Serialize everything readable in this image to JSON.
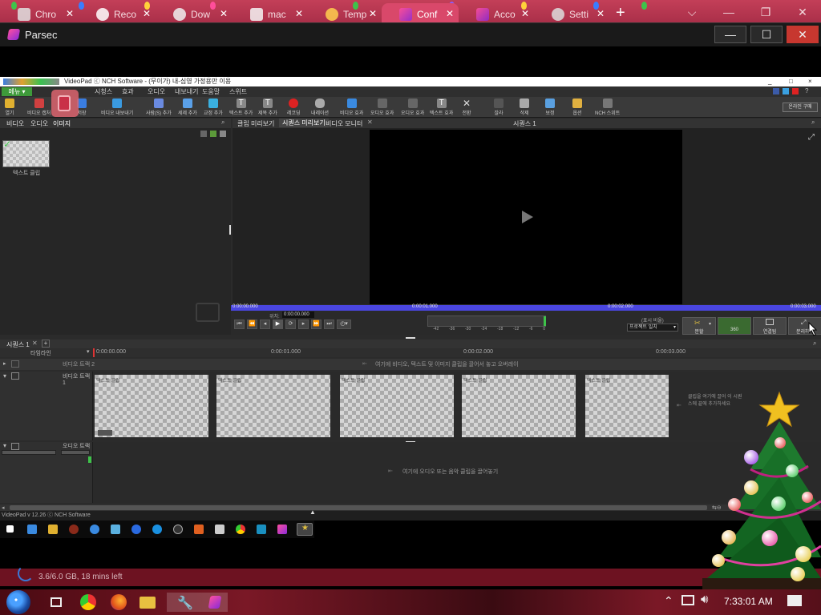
{
  "browser": {
    "tabs": [
      {
        "label": "Chro",
        "icon": "chrome-icon"
      },
      {
        "label": "Reco",
        "icon": "google-icon"
      },
      {
        "label": "Dow",
        "icon": "download-icon"
      },
      {
        "label": "mac",
        "icon": "bank-icon"
      },
      {
        "label": "Temp",
        "icon": "temp-icon"
      },
      {
        "label": "Conf",
        "icon": "parsec-icon",
        "active": true
      },
      {
        "label": "Acco",
        "icon": "parsec-icon"
      },
      {
        "label": "Setti",
        "icon": "gear-icon"
      }
    ],
    "new_tab": "+",
    "controls": {
      "dropdown": "⌵",
      "minimize": "—",
      "restore": "❐",
      "close": "✕"
    }
  },
  "parsec": {
    "title": "Parsec",
    "minimize": "—",
    "maximize": "☐",
    "close": "✕"
  },
  "videopad": {
    "title": "VideoPad ⓒ NCH Software - (무이가) 내-심영 가정용만 이용",
    "window_controls": {
      "minimize": "_",
      "restore": "□",
      "close": "×"
    },
    "menu": [
      "메뉴 ▾",
      "시청스",
      "효과",
      "오디오",
      "내보내기",
      "도움말",
      "스위트"
    ],
    "toolbar": [
      "열기",
      "비디오 캡처",
      "저장",
      "비디오 내보내기",
      "사람(S) 추가",
      "세제 추가",
      "교정 추가",
      "텍스트 추가",
      "제목 추가",
      "레코딩",
      "내레이션",
      "비디오 효과",
      "오디오 효과",
      "오디오 효과",
      "텍스트 효과",
      "전환",
      "잘라",
      "삭제",
      "보정",
      "옵션",
      "NCH 스위트"
    ],
    "online_button": "온라인 구매",
    "bin_tabs": [
      "비디오",
      "오디오",
      "이미지"
    ],
    "bin_item_label": "텍스트 클립",
    "preview_tabs": [
      "클립 미리보기",
      "시퀀스 미리보기",
      "비디오 모니터"
    ],
    "sequence_label": "시퀀스 1",
    "seek_marks": [
      "0:00:00.000",
      "0:00:01.000",
      "0:00:02.000",
      "0:00:03.000"
    ],
    "position_label": "위치:",
    "position_value": "0:00:00.000",
    "meter_scale": [
      "-42",
      "-36",
      "-30",
      "-24",
      "-18",
      "-12",
      "-6",
      "0"
    ],
    "ratio_label": "(표시 비율)",
    "ratio_value": "프로젝트 일치",
    "buttons": {
      "split": "분할",
      "x360": "360",
      "unlink": "연결됨",
      "fullscreen": "분리하기"
    },
    "timeline": {
      "tab": "시퀀스 1",
      "timeline_label": "타임라인",
      "ruler": [
        "0:00:00.000",
        "0:00:01.000",
        "0:00:02.000",
        "0:00:03.000"
      ],
      "overlay_track": "비디오 트랙 2",
      "overlay_hint": "여기에 비디오, 텍스트 및 이미지 클립을 끌어서 놓고 오버레이",
      "video_track": "비디오 트랙 1",
      "clip_label": "텍스트 클립",
      "video_drop_hint": "클립을 여기에 끌어 이 시퀀스에 끝에 추가하세요",
      "audio_track": "오디오 트랙 1",
      "audio_hint": "여기에 오디오 또는 음악 클립을 끌어놓기"
    },
    "status": "VideoPad v 12.26 ⓒ NCH Software"
  },
  "download_status": "3.6/6.0 GB, 18 mins left",
  "taskbar": {
    "clock": "7:33:01 AM",
    "apps": [
      "start-icon",
      "task-view-icon",
      "chrome-icon",
      "firefox-icon",
      "file-explorer-icon",
      "tools-icon",
      "parsec-icon"
    ]
  },
  "colors": {
    "tabstrip": "#b8334f",
    "parsec_titlebar": "#1a1a1a",
    "seekbar": "#4a46e0",
    "close_red": "#c7372f"
  }
}
